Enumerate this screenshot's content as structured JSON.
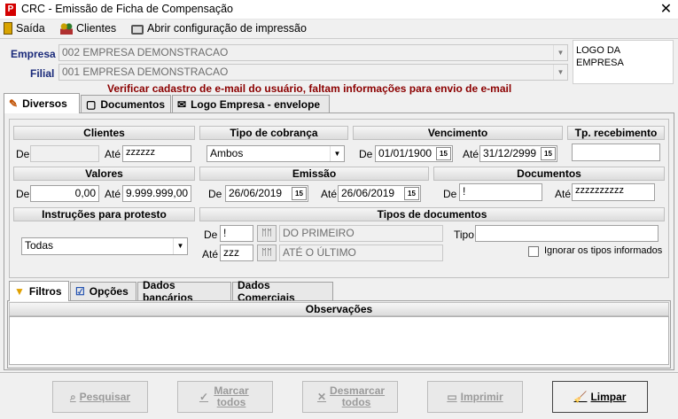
{
  "window": {
    "title": "CRC - Emissão de Ficha de Compensação",
    "close": "✕",
    "app_icon": "P"
  },
  "menu": {
    "saida": "Saída",
    "clientes": "Clientes",
    "impressao": "Abrir configuração de impressão"
  },
  "header": {
    "empresa_label": "Empresa",
    "empresa_value": "002 EMPRESA DEMONSTRACAO",
    "filial_label": "Filial",
    "filial_value": "001 EMPRESA DEMONSTRACAO",
    "logo_text": "LOGO DA EMPRESA",
    "warning": "Verificar cadastro de e-mail do usuário, faltam informações para envio de e-mail"
  },
  "tabs_top": [
    "Diversos",
    "Documentos",
    "Logo Empresa - envelope"
  ],
  "clientes": {
    "title": "Clientes",
    "de_label": "De",
    "de_value": "",
    "ate_label": "Até",
    "ate_value": "zzzzzz"
  },
  "tipo_cobranca": {
    "title": "Tipo de cobrança",
    "value": "Ambos"
  },
  "vencimento": {
    "title": "Vencimento",
    "de_label": "De",
    "de_value": "01/01/1900",
    "ate_label": "Até",
    "ate_value": "31/12/2999",
    "cal": "15"
  },
  "tp_recebimento": {
    "title": "Tp. recebimento",
    "value": ""
  },
  "valores": {
    "title": "Valores",
    "de_label": "De",
    "de_value": "0,00",
    "ate_label": "Até",
    "ate_value": "9.999.999,00"
  },
  "emissao": {
    "title": "Emissão",
    "de_label": "De",
    "de_value": "26/06/2019",
    "ate_label": "Até",
    "ate_value": "26/06/2019",
    "cal": "15"
  },
  "documentos": {
    "title": "Documentos",
    "de_label": "De",
    "de_value": "!",
    "ate_label": "Até",
    "ate_value": "zzzzzzzzzz"
  },
  "instrucoes": {
    "title": "Instruções para protesto",
    "value": "Todas"
  },
  "tipos_documentos": {
    "title": "Tipos de documentos",
    "de_label": "De",
    "de_value": "!",
    "de_desc": "DO PRIMEIRO",
    "ate_label": "Até",
    "ate_value": "zzz",
    "ate_desc": "ATÉ O ÚLTIMO",
    "tipo_label": "Tipo",
    "tipo_value": "",
    "ignorar_label": "Ignorar os tipos informados"
  },
  "tabs_bottom": [
    "Filtros",
    "Opções",
    "Dados bancários",
    "Dados Comerciais"
  ],
  "observacoes": {
    "title": "Observações"
  },
  "buttons": {
    "pesquisar": "Pesquisar",
    "marcar": "Marcar todos",
    "desmarcar": "Desmarcar todos",
    "imprimir": "Imprimir",
    "limpar": "Limpar"
  }
}
